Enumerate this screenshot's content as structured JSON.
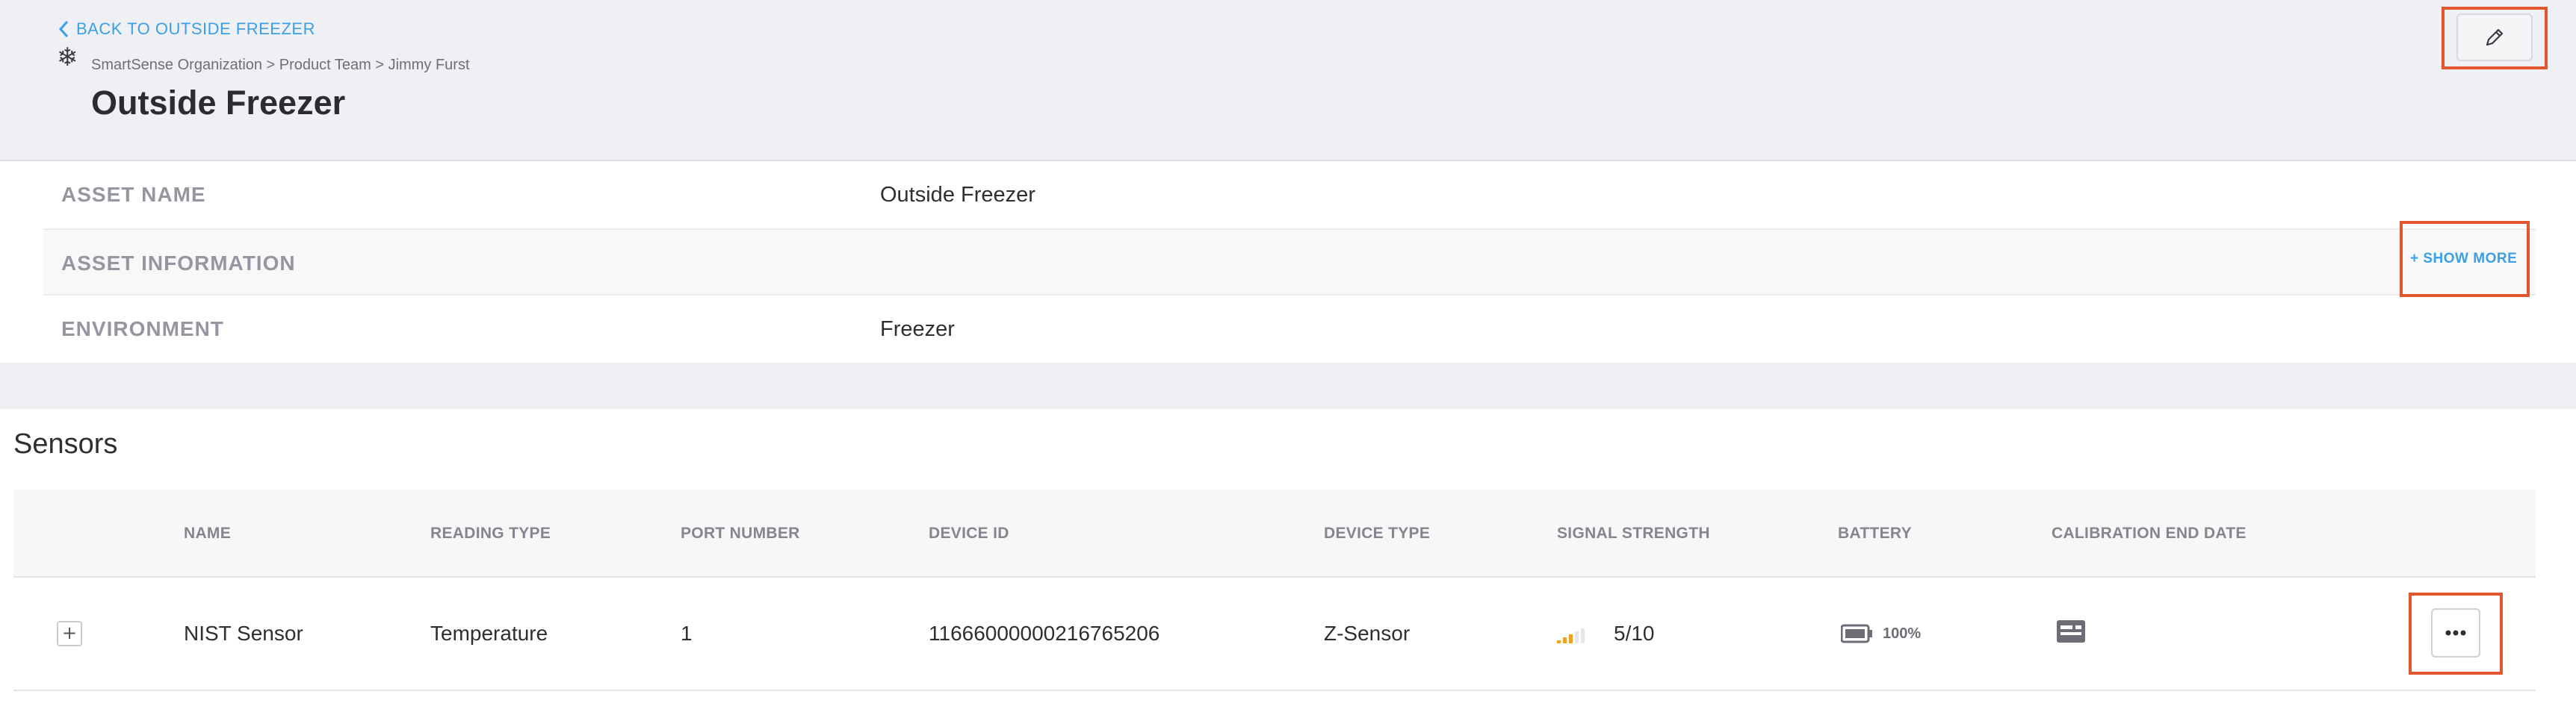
{
  "header": {
    "back_label": "BACK TO OUTSIDE FREEZER",
    "breadcrumb": "SmartSense Organization > Product Team > Jimmy Furst",
    "title": "Outside Freezer",
    "icon": "snowflake-icon"
  },
  "asset_info": {
    "rows": [
      {
        "label": "ASSET NAME",
        "value": "Outside Freezer"
      },
      {
        "label": "ASSET INFORMATION",
        "value": ""
      },
      {
        "label": "ENVIRONMENT",
        "value": "Freezer"
      }
    ],
    "show_more_label": "+ SHOW MORE"
  },
  "sensors": {
    "title": "Sensors",
    "columns": [
      "NAME",
      "READING TYPE",
      "PORT NUMBER",
      "DEVICE ID",
      "DEVICE TYPE",
      "SIGNAL STRENGTH",
      "BATTERY",
      "CALIBRATION END DATE"
    ],
    "rows": [
      {
        "expand_label": "+",
        "name": "NIST Sensor",
        "reading_type": "Temperature",
        "port_number": "1",
        "device_id": "11666000000216765206",
        "device_type": "Z-Sensor",
        "signal_strength": "5/10",
        "signal_level": 0.5,
        "battery": "100%",
        "battery_level": 1.0
      }
    ]
  },
  "colors": {
    "accent": "#3b9fe6",
    "highlight": "#e2562e",
    "signal": "#f0a020",
    "header_bg": "#eff0f4"
  }
}
